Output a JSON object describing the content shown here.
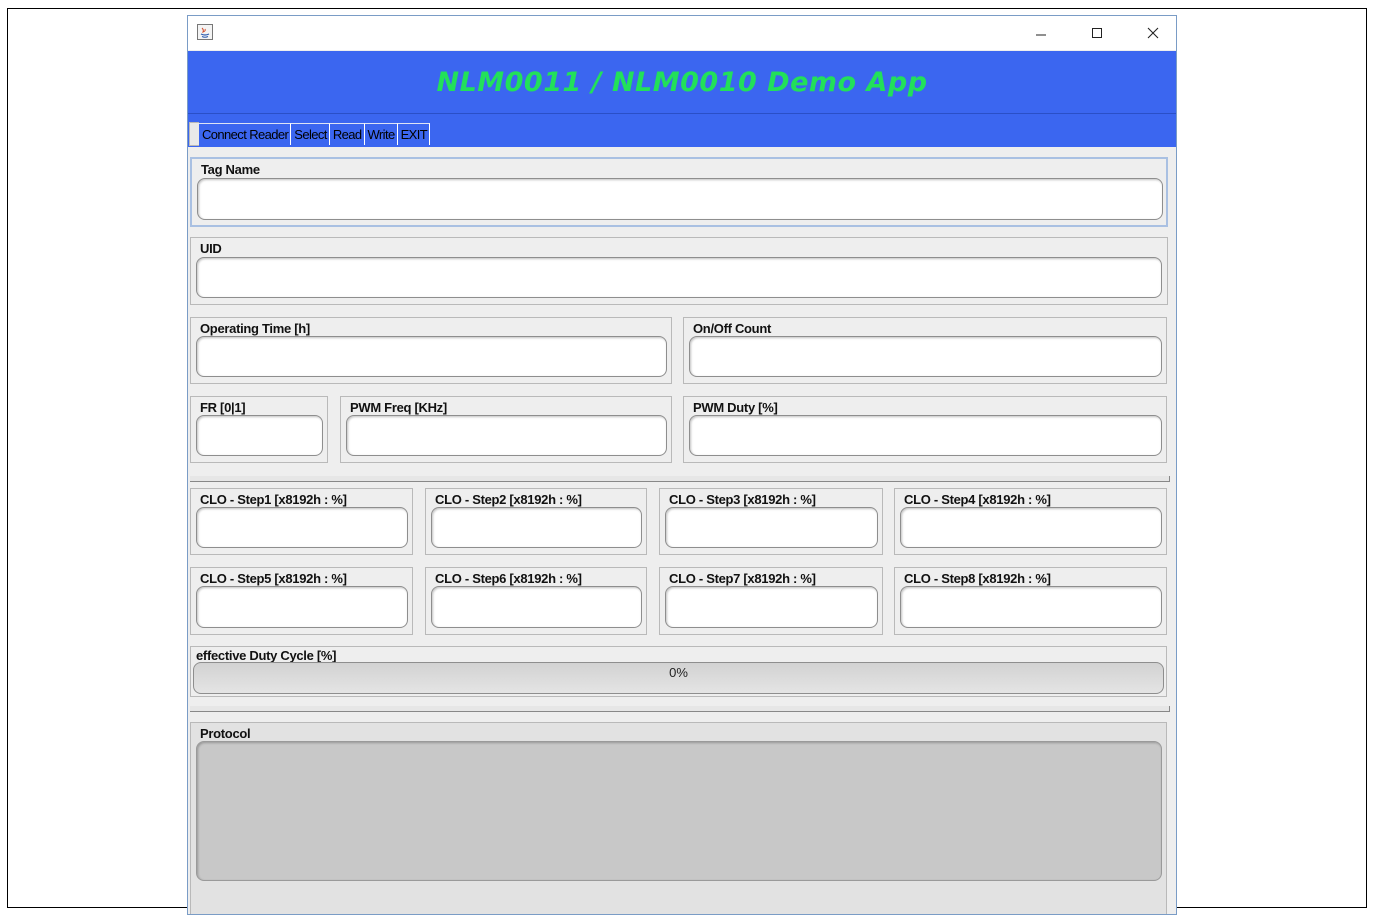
{
  "window": {
    "banner_title": "NLM0011 / NLM0010 Demo App"
  },
  "menu": {
    "items": [
      "Connect Reader",
      "Select",
      "Read",
      "Write",
      "EXIT"
    ]
  },
  "fields": {
    "tag_name": "Tag Name",
    "uid": "UID",
    "operating_time": "Operating Time [h]",
    "onoff_count": "On/Off Count",
    "fr": "FR [0|1]",
    "pwm_freq": "PWM Freq [KHz]",
    "pwm_duty": "PWM Duty [%]"
  },
  "clo_steps": [
    "CLO - Step1 [x8192h : %]",
    "CLO - Step2 [x8192h : %]",
    "CLO - Step3 [x8192h : %]",
    "CLO - Step4 [x8192h : %]",
    "CLO - Step5 [x8192h : %]",
    "CLO - Step6 [x8192h : %]",
    "CLO - Step7 [x8192h : %]",
    "CLO - Step8 [x8192h : %]"
  ],
  "duty_cycle": {
    "label": "effective Duty Cycle [%]",
    "value_text": "0%",
    "value": 0
  },
  "protocol": {
    "label": "Protocol"
  },
  "colors": {
    "banner_bg": "#3b66f0",
    "banner_text": "#22e05a"
  }
}
